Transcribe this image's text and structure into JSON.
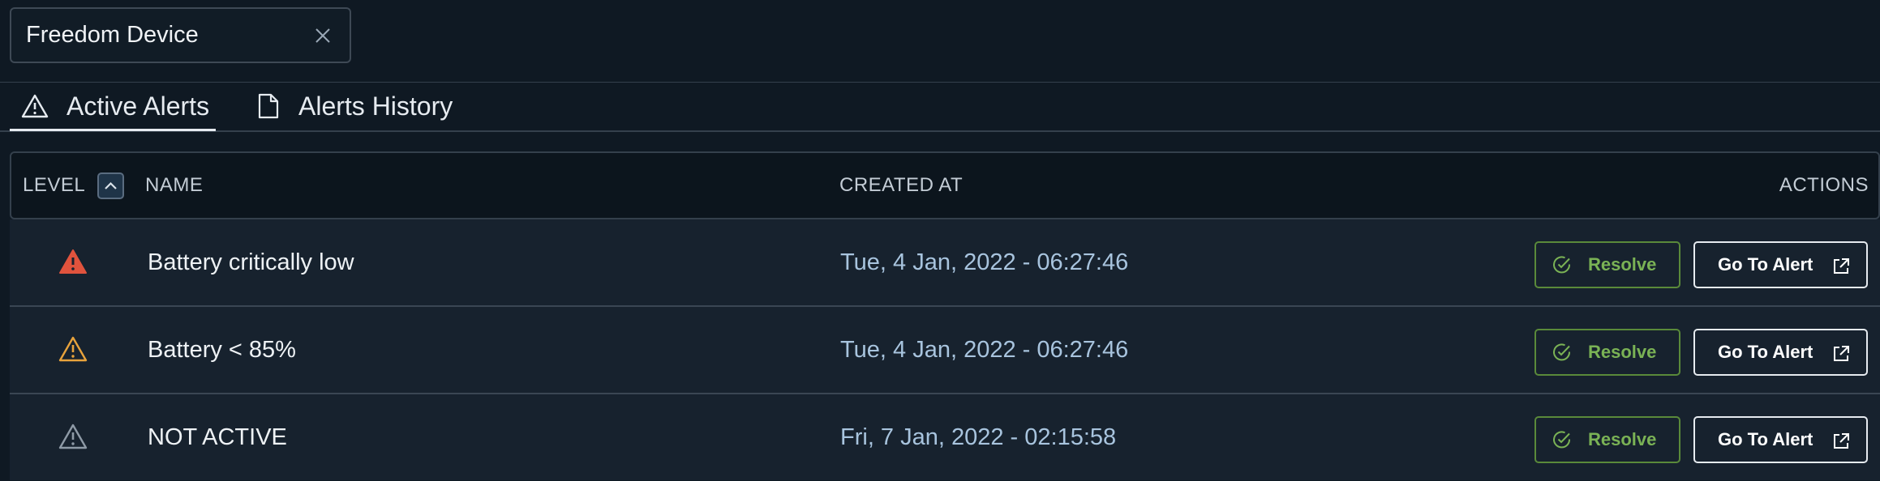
{
  "device_filter": {
    "label": "Freedom Device",
    "close_icon": "close-icon"
  },
  "tabs": [
    {
      "label": "Active Alerts",
      "icon": "warning-triangle-icon",
      "active": true
    },
    {
      "label": "Alerts History",
      "icon": "document-icon",
      "active": false
    }
  ],
  "table": {
    "headers": {
      "level": "LEVEL",
      "name": "NAME",
      "created_at": "CREATED AT",
      "actions": "ACTIONS"
    },
    "sort_icon": "chevron-up-icon",
    "rows": [
      {
        "level": "critical",
        "level_color": "#e0533d",
        "name": "Battery critically low",
        "created_at": "Tue, 4 Jan, 2022 - 06:27:46",
        "resolve_label": "Resolve",
        "goto_label": "Go To Alert"
      },
      {
        "level": "warning",
        "level_color": "#e8a33c",
        "name": "Battery < 85%",
        "created_at": "Tue, 4 Jan, 2022 - 06:27:46",
        "resolve_label": "Resolve",
        "goto_label": "Go To Alert"
      },
      {
        "level": "inactive",
        "level_color": "#8e9aa6",
        "name": "NOT ACTIVE",
        "created_at": "Fri, 7 Jan, 2022 - 02:15:58",
        "resolve_label": "Resolve",
        "goto_label": "Go To Alert"
      }
    ]
  },
  "colors": {
    "background": "#0f1923",
    "row_bg": "#17222e",
    "resolve_green": "#7ab255",
    "created_at_text": "#a8c4de"
  }
}
